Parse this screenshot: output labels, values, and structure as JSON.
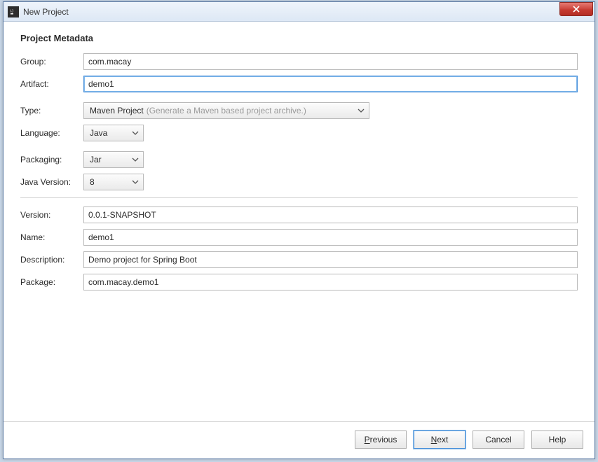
{
  "window": {
    "title": "New Project"
  },
  "heading": "Project Metadata",
  "labels": {
    "group": "Group:",
    "artifact": "Artifact:",
    "type": "Type:",
    "language": "Language:",
    "packaging": "Packaging:",
    "javaVersion": "Java Version:",
    "version": "Version:",
    "name": "Name:",
    "description": "Description:",
    "package": "Package:"
  },
  "fields": {
    "group": "com.macay",
    "artifact": "demo1",
    "type": "Maven Project",
    "typeHint": "(Generate a Maven based project archive.)",
    "language": "Java",
    "packaging": "Jar",
    "javaVersion": "8",
    "version": "0.0.1-SNAPSHOT",
    "name": "demo1",
    "description": "Demo project for Spring Boot",
    "package": "com.macay.demo1"
  },
  "buttons": {
    "previous": "revious",
    "previous_mn": "P",
    "next": "ext",
    "next_mn": "N",
    "cancel": "Cancel",
    "help": "Help"
  }
}
